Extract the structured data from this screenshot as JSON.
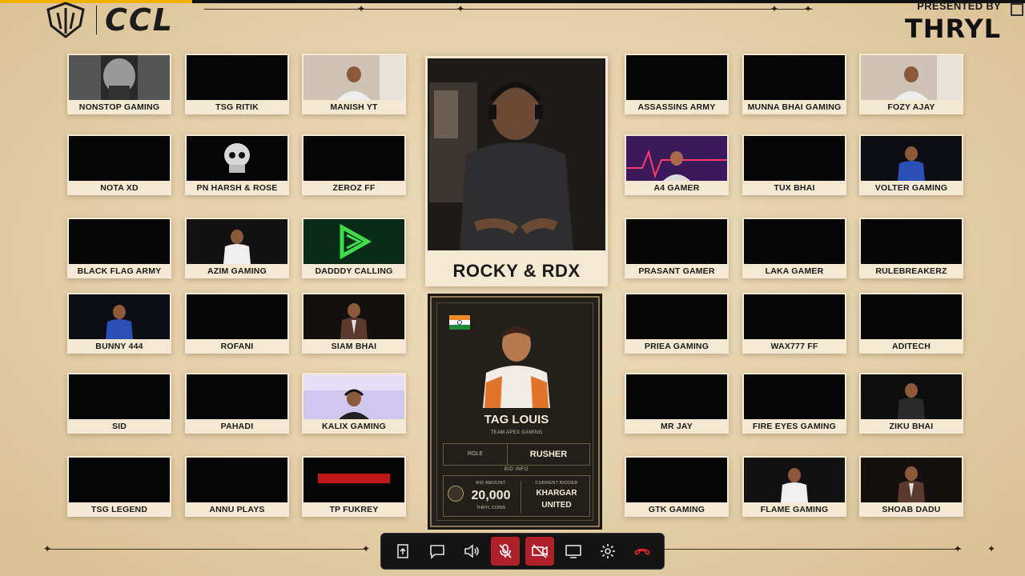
{
  "header": {
    "logo_text": "CCL",
    "presented_by": "PRESENTED BY",
    "sponsor": "THRYL"
  },
  "main_speaker": {
    "name": "ROCKY & RDX"
  },
  "player_card": {
    "country_flag": "india-flag",
    "name": "TAG LOUIS",
    "team": "TEAM APEX GAMING",
    "role_label": "ROLE",
    "role": "RUSHER",
    "bid_info_label": "BID INFO",
    "bid_amount_label": "BID AMOUNT",
    "bid_amount": "20,000",
    "bid_currency": "THRYL COINS",
    "current_bidder_label": "CURRENT BIDDER",
    "current_bidder_line1": "KHARGAR",
    "current_bidder_line2": "UNITED"
  },
  "participants": [
    {
      "name": "NONSTOP GAMING",
      "video": "person-mask"
    },
    {
      "name": "TSG RITIK",
      "video": "off"
    },
    {
      "name": "MANISH YT",
      "video": "person-room"
    },
    {
      "name": "NOTA XD",
      "video": "off"
    },
    {
      "name": "PN HARSH & ROSE",
      "video": "skull-logo"
    },
    {
      "name": "ZEROZ FF",
      "video": "off"
    },
    {
      "name": "BLACK FLAG ARMY",
      "video": "off"
    },
    {
      "name": "AZIM GAMING",
      "video": "person-white"
    },
    {
      "name": "DADDDY CALLING",
      "video": "green-logo"
    },
    {
      "name": "BUNNY 444",
      "video": "person-blue"
    },
    {
      "name": "ROFANI",
      "video": "off"
    },
    {
      "name": "SIAM BHAI",
      "video": "person-suit"
    },
    {
      "name": "SID",
      "video": "off"
    },
    {
      "name": "PAHADI",
      "video": "off"
    },
    {
      "name": "KALIX GAMING",
      "video": "person-headset"
    },
    {
      "name": "TSG LEGEND",
      "video": "off"
    },
    {
      "name": "ANNU PLAYS",
      "video": "off"
    },
    {
      "name": "TP FUKREY",
      "video": "red-banner"
    },
    {
      "name": "ASSASSINS ARMY",
      "video": "off"
    },
    {
      "name": "MUNNA BHAI GAMING",
      "video": "off"
    },
    {
      "name": "FOZY AJAY",
      "video": "person-room"
    },
    {
      "name": "A4 GAMER",
      "video": "person-pink"
    },
    {
      "name": "TUX BHAI",
      "video": "off"
    },
    {
      "name": "VOLTER GAMING",
      "video": "person-blue"
    },
    {
      "name": "PRASANT GAMER",
      "video": "off"
    },
    {
      "name": "LAKA GAMER",
      "video": "off"
    },
    {
      "name": "RULEBREAKERZ",
      "video": "off"
    },
    {
      "name": "PRIEA GAMING",
      "video": "off"
    },
    {
      "name": "WAX777 FF",
      "video": "off"
    },
    {
      "name": "ADITECH",
      "video": "off"
    },
    {
      "name": "MR JAY",
      "video": "off"
    },
    {
      "name": "FIRE EYES GAMING",
      "video": "off"
    },
    {
      "name": "ZIKU BHAI",
      "video": "person-dark"
    },
    {
      "name": "GTK GAMING",
      "video": "off"
    },
    {
      "name": "FLAME GAMING",
      "video": "person-white"
    },
    {
      "name": "SHOAB DADU",
      "video": "person-suit"
    }
  ],
  "toolbar": [
    {
      "name": "share-icon",
      "state": "normal"
    },
    {
      "name": "chat-icon",
      "state": "normal"
    },
    {
      "name": "speaker-icon",
      "state": "normal"
    },
    {
      "name": "mic-off-icon",
      "state": "muted"
    },
    {
      "name": "camera-off-icon",
      "state": "muted"
    },
    {
      "name": "screen-share-icon",
      "state": "normal"
    },
    {
      "name": "settings-icon",
      "state": "normal"
    },
    {
      "name": "hang-up-icon",
      "state": "danger"
    }
  ],
  "colors": {
    "background": "#e6d3ad",
    "tile_frame": "#f4ead3",
    "card_bg": "#23201b",
    "danger": "#b0202a"
  }
}
